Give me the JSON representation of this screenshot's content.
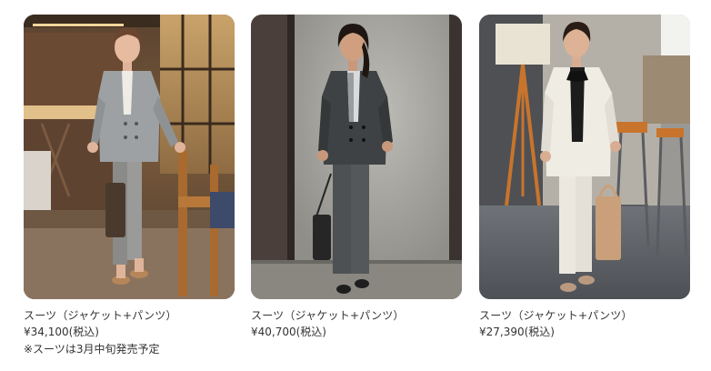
{
  "products": [
    {
      "name": "スーツ（ジャケット+パンツ）",
      "price": "¥34,100(税込)",
      "note": "※スーツは3月中旬発売予定",
      "image_desc": "woman-grey-suit-restaurant"
    },
    {
      "name": "スーツ（ジャケット+パンツ）",
      "price": "¥40,700(税込)",
      "note": "",
      "image_desc": "woman-charcoal-suit-concrete-wall"
    },
    {
      "name": "スーツ（ジャケット+パンツ）",
      "price": "¥27,390(税込)",
      "note": "",
      "image_desc": "woman-ivory-suit-cafe"
    }
  ],
  "colors": {
    "text": "#333333",
    "background": "#ffffff"
  }
}
